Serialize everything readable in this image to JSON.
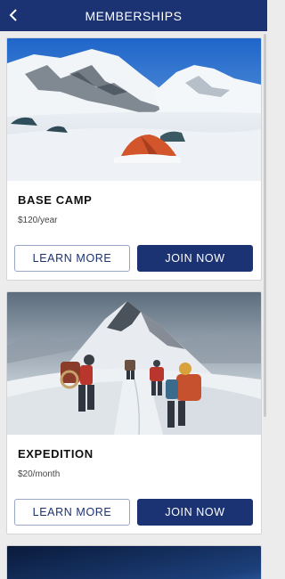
{
  "header": {
    "title": "MEMBERSHIPS",
    "back_icon": "chevron-left-icon",
    "color": "#1b3273"
  },
  "memberships": [
    {
      "title": "BASE CAMP",
      "price": "$120/year",
      "learn_more_label": "LEARN MORE",
      "join_label": "JOIN NOW"
    },
    {
      "title": "EXPEDITION",
      "price": "$20/month",
      "learn_more_label": "LEARN MORE",
      "join_label": "JOIN NOW"
    }
  ],
  "accent_color": "#1b3273"
}
